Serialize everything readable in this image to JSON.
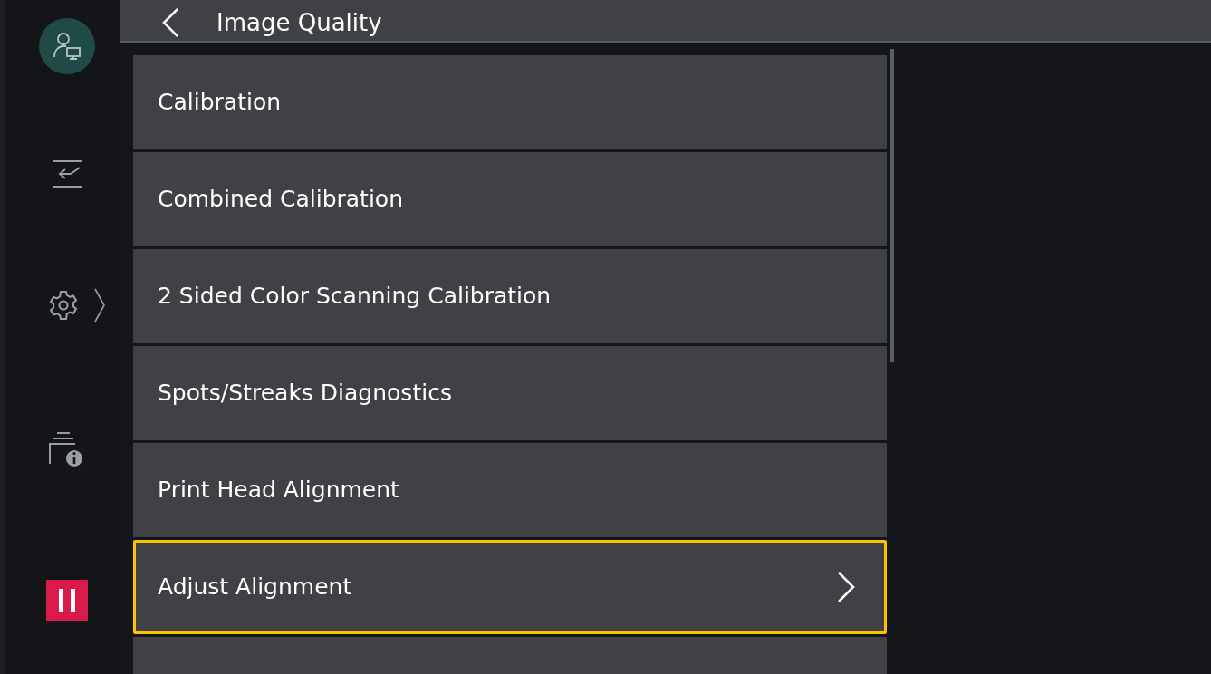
{
  "header": {
    "title": "Image Quality"
  },
  "sidebar": {
    "items": [
      {
        "kind": "user"
      },
      {
        "kind": "transfer"
      },
      {
        "kind": "settings"
      },
      {
        "kind": "device-info"
      },
      {
        "kind": "pause"
      }
    ]
  },
  "menu": {
    "items": [
      {
        "label": "Calibration",
        "highlighted": false,
        "chevron": false
      },
      {
        "label": "Combined Calibration",
        "highlighted": false,
        "chevron": false
      },
      {
        "label": "2 Sided Color Scanning Calibration",
        "highlighted": false,
        "chevron": false
      },
      {
        "label": "Spots/Streaks Diagnostics",
        "highlighted": false,
        "chevron": false
      },
      {
        "label": "Print Head Alignment",
        "highlighted": false,
        "chevron": false
      },
      {
        "label": "Adjust Alignment",
        "highlighted": true,
        "chevron": true
      }
    ]
  }
}
